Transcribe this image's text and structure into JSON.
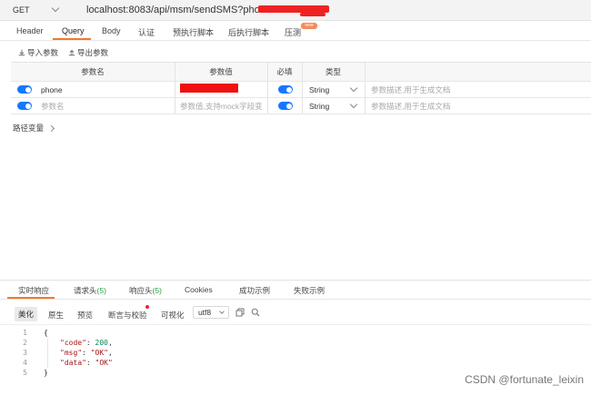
{
  "request": {
    "method": "GET",
    "url": "localhost:8083/api/msm/sendSMS?phone="
  },
  "tabs": [
    {
      "label": "Header"
    },
    {
      "label": "Query"
    },
    {
      "label": "Body"
    },
    {
      "label": "认证"
    },
    {
      "label": "预执行脚本"
    },
    {
      "label": "后执行脚本"
    },
    {
      "label": "压测"
    }
  ],
  "badge": "new",
  "actions": {
    "import": "导入参数",
    "export": "导出参数"
  },
  "params": {
    "headers": [
      "参数名",
      "参数值",
      "必填",
      "类型"
    ],
    "rows": [
      {
        "name": "phone",
        "value": "",
        "type": "String",
        "desc_placeholder": "参数描述,用于生成文档"
      }
    ],
    "new_row": {
      "name_placeholder": "参数名",
      "value_placeholder": "参数值,支持mock字段变",
      "type": "String",
      "desc_placeholder": "参数描述,用于生成文档"
    }
  },
  "path_vars": "路径变量",
  "response": {
    "tabs": [
      {
        "label": "实时响应"
      },
      {
        "label": "请求头",
        "count": "(5)"
      },
      {
        "label": "响应头",
        "count": "(5)"
      },
      {
        "label": "Cookies"
      },
      {
        "label": "成功示例"
      },
      {
        "label": "失败示例"
      }
    ],
    "tools": [
      "美化",
      "原生",
      "预览",
      "断言与校验",
      "可视化"
    ],
    "encoding": "utf8",
    "code_lines": [
      "{",
      "\"code\": 200,",
      "\"msg\": \"OK\",",
      "\"data\": \"OK\"",
      "}"
    ],
    "line_numbers": [
      "1",
      "2",
      "3",
      "4",
      "5"
    ]
  },
  "watermark": "CSDN @fortunate_leixin",
  "colors": {
    "accent": "#f07a2a",
    "toggle": "#1677ff",
    "success": "#2ea043"
  }
}
